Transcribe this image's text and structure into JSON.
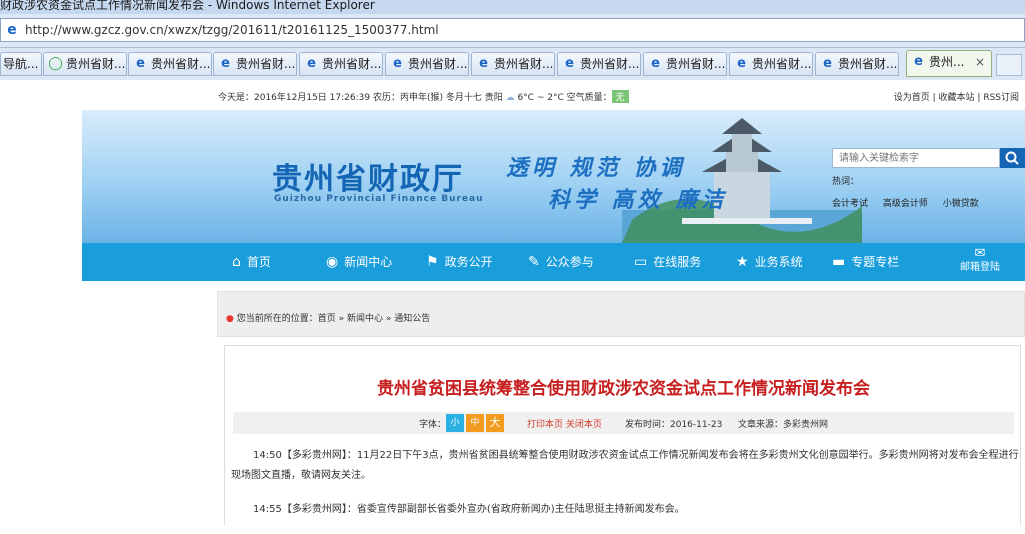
{
  "browser": {
    "window_title": "财政涉农资金试点工作情况新闻发布会 - Windows Internet Explorer",
    "url": "http://www.gzcz.gov.cn/xwzx/tzgg/201611/t20161125_1500377.html",
    "tabs": [
      {
        "label": "导航..."
      },
      {
        "label": "贵州省财..."
      },
      {
        "label": "贵州省财..."
      },
      {
        "label": "贵州省财..."
      },
      {
        "label": "贵州省财..."
      },
      {
        "label": "贵州省财..."
      },
      {
        "label": "贵州省财..."
      },
      {
        "label": "贵州省财..."
      },
      {
        "label": "贵州省财..."
      },
      {
        "label": "贵州省财..."
      },
      {
        "label": "贵州省财..."
      },
      {
        "label": "贵州..."
      }
    ],
    "active_tab_close": "×"
  },
  "topinfo": {
    "date_text": "今天是：2016年12月15日 17:26:39 农历：丙申年(猴) 冬月十七  贵阳",
    "temperature": "6°C ~ 2°C",
    "air_label": "空气质量：",
    "air_value": "无",
    "links": [
      "设为首页",
      "收藏本站",
      "RSS订阅"
    ]
  },
  "banner": {
    "site_name": "贵州省财政厅",
    "site_name_en": "Guizhou Provincial Finance Bureau",
    "slogan_line1": "透明 规范 协调",
    "slogan_line2": "科学 高效 廉洁",
    "search_placeholder": "请输入关键检索字",
    "hot_label": "热词：",
    "hot_words": [
      "会计考试",
      "高级会计师",
      "小微贷款"
    ]
  },
  "nav": {
    "items": [
      {
        "label": "首页",
        "icon": "home-icon"
      },
      {
        "label": "新闻中心",
        "icon": "target-icon"
      },
      {
        "label": "政务公开",
        "icon": "flag-icon"
      },
      {
        "label": "公众参与",
        "icon": "edit-icon"
      },
      {
        "label": "在线服务",
        "icon": "monitor-icon"
      },
      {
        "label": "业务系统",
        "icon": "star-icon"
      },
      {
        "label": "专题专栏",
        "icon": "bus-icon"
      },
      {
        "label": "邮箱登陆",
        "icon": "mail-icon"
      }
    ]
  },
  "breadcrumb": {
    "text": "您当前所在的位置：首页 » 新闻中心 » 通知公告"
  },
  "article": {
    "title": "贵州省贫困县统筹整合使用财政涉农资金试点工作情况新闻发布会",
    "font_label": "字体：",
    "font_small": "小",
    "font_medium": "中",
    "font_large": "大",
    "print_links": "打印本页 关闭本页",
    "publish_time": "发布时间：2016-11-23",
    "source": "文章来源：多彩贵州网",
    "paragraphs": [
      "14:50【多彩贵州网】：11月22日下午3点，贵州省贫困县统筹整合使用财政涉农资金试点工作情况新闻发布会将在多彩贵州文化创意园举行。多彩贵州网将对发布会全程进行现场图文直播，敬请网友关注。",
      "14:55【多彩贵州网】：省委宣传部副部长省委外宣办(省政府新闻办)主任陆思挺主持新闻发布会。"
    ]
  },
  "colors": {
    "nav_bg": "#1a9ddb",
    "title_red": "#c71f1f",
    "brand_blue": "#1565b5"
  }
}
